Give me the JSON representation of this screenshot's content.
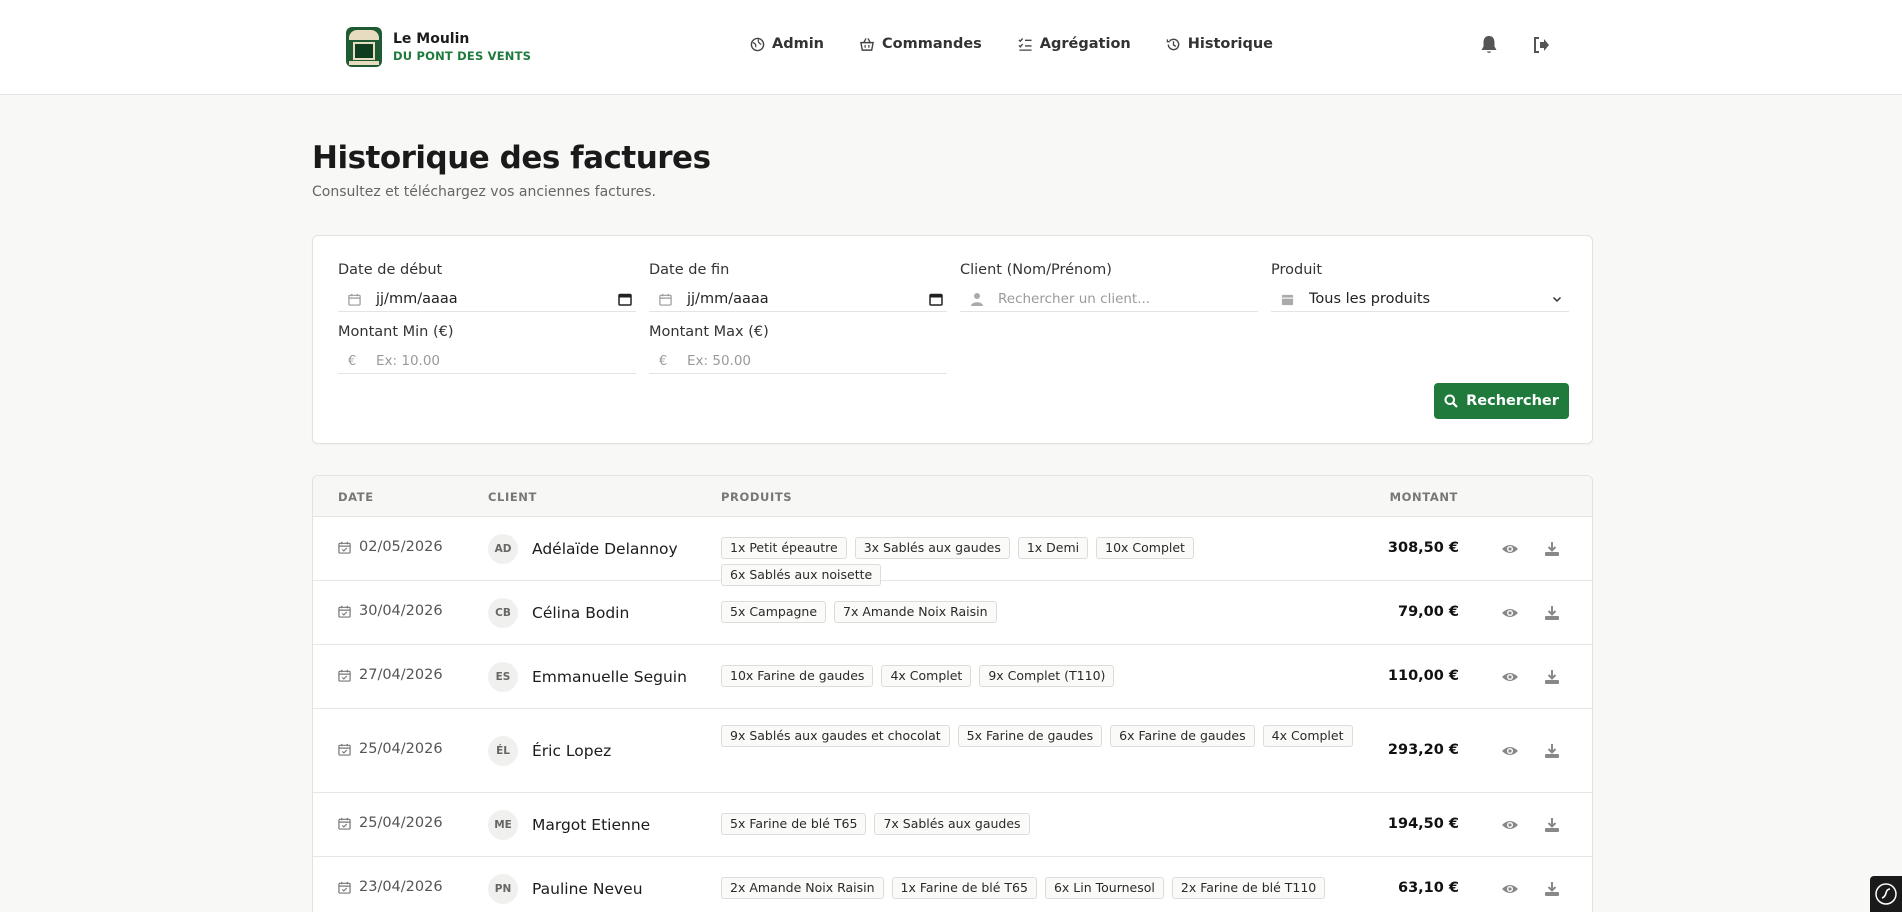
{
  "brand": {
    "name_line1": "Le Moulin",
    "name_line2": "DU PONT DES VENTS"
  },
  "nav": [
    {
      "label": "Admin",
      "icon": "globe-icon"
    },
    {
      "label": "Commandes",
      "icon": "basket-icon"
    },
    {
      "label": "Agrégation",
      "icon": "checklist-icon"
    },
    {
      "label": "Historique",
      "icon": "history-icon"
    }
  ],
  "header_icons": [
    "bell-icon",
    "logout-icon"
  ],
  "page": {
    "title": "Historique des factures",
    "subtitle": "Consultez et téléchargez vos anciennes factures."
  },
  "filters": {
    "date_start": {
      "label": "Date de début",
      "value": "jj/mm/aaaa"
    },
    "date_end": {
      "label": "Date de fin",
      "value": "jj/mm/aaaa"
    },
    "client": {
      "label": "Client (Nom/Prénom)",
      "placeholder": "Rechercher un client..."
    },
    "product": {
      "label": "Produit",
      "value": "Tous les produits"
    },
    "amount_min": {
      "label": "Montant Min (€)",
      "placeholder": "Ex: 10.00",
      "symbol": "€"
    },
    "amount_max": {
      "label": "Montant Max (€)",
      "placeholder": "Ex: 50.00",
      "symbol": "€"
    },
    "search_button": "Rechercher"
  },
  "table": {
    "headers": {
      "date": "DATE",
      "client": "CLIENT",
      "products": "PRODUITS",
      "amount": "MONTANT"
    },
    "rows": [
      {
        "date": "02/05/2026",
        "initials": "AD",
        "client": "Adélaïde Delannoy",
        "products": [
          "1x Petit épeautre",
          "3x Sablés aux gaudes",
          "1x Demi",
          "10x Complet",
          "6x Sablés aux noisette"
        ],
        "amount": "308,50 €"
      },
      {
        "date": "30/04/2026",
        "initials": "CB",
        "client": "Célina Bodin",
        "products": [
          "5x Campagne",
          "7x Amande Noix Raisin"
        ],
        "amount": "79,00 €"
      },
      {
        "date": "27/04/2026",
        "initials": "ES",
        "client": "Emmanuelle Seguin",
        "products": [
          "10x Farine de gaudes",
          "4x Complet",
          "9x Complet (T110)"
        ],
        "amount": "110,00 €"
      },
      {
        "date": "25/04/2026",
        "initials": "ÉL",
        "client": "Éric Lopez",
        "products": [
          "9x Sablés aux gaudes et chocolat",
          "5x Farine de gaudes",
          "6x Farine de gaudes",
          "4x Complet"
        ],
        "amount": "293,20 €"
      },
      {
        "date": "25/04/2026",
        "initials": "ME",
        "client": "Margot Etienne",
        "products": [
          "5x Farine de blé T65",
          "7x Sablés aux gaudes"
        ],
        "amount": "194,50 €"
      },
      {
        "date": "23/04/2026",
        "initials": "PN",
        "client": "Pauline Neveu",
        "products": [
          "2x Amande Noix Raisin",
          "1x Farine de blé T65",
          "6x Lin Tournesol",
          "2x Farine de blé T110"
        ],
        "amount": "63,10 €"
      }
    ]
  },
  "colors": {
    "accent": "#1f7a3c",
    "background": "#f8f8f6",
    "border": "#e2e2df"
  }
}
